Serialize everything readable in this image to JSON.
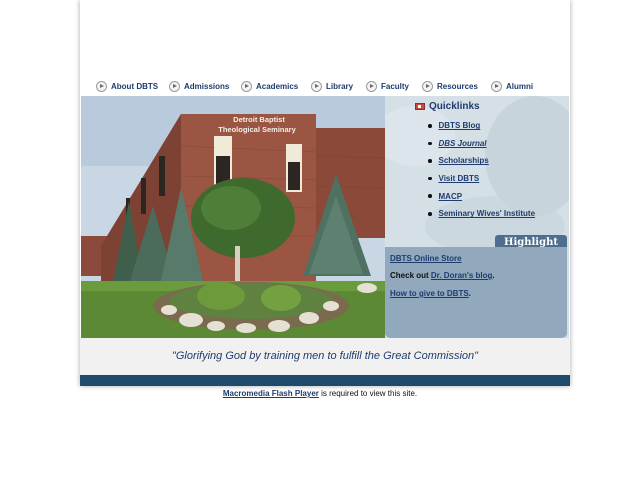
{
  "nav": {
    "items": [
      {
        "label": "About DBTS"
      },
      {
        "label": "Admissions"
      },
      {
        "label": "Academics"
      },
      {
        "label": "Library"
      },
      {
        "label": "Faculty"
      },
      {
        "label": "Resources"
      },
      {
        "label": "Alumni"
      }
    ]
  },
  "photo": {
    "sign_line1": "Detroit Baptist",
    "sign_line2": "Theological Seminary"
  },
  "quicklinks": {
    "title": "Quicklinks",
    "items": [
      {
        "label": "DBTS Blog"
      },
      {
        "label": "DBS Journal"
      },
      {
        "label": "Scholarships"
      },
      {
        "label": "Visit DBTS"
      },
      {
        "label": "MACP"
      },
      {
        "label": "Seminary Wives' Institute"
      }
    ]
  },
  "highlight": {
    "tab_label": "Highlight",
    "store_link": "DBTS Online Store",
    "check_out_prefix": "Check out ",
    "blog_link": "Dr. Doran's blog",
    "blog_suffix": ".",
    "give_link": "How to give to DBTS",
    "give_suffix": "."
  },
  "tagline": "\"Glorifying God by training men to fulfill the Great Commission\"",
  "footer_note": {
    "link": "Macromedia Flash Player",
    "suffix": " is required to view this site."
  },
  "colors": {
    "nav_text": "#1e3c6e",
    "footer_bar": "#1e4a6b",
    "highlight_box": "#92a9bd",
    "highlight_tab": "#4f6e8e",
    "panel_bg": "#cdd9e1"
  }
}
